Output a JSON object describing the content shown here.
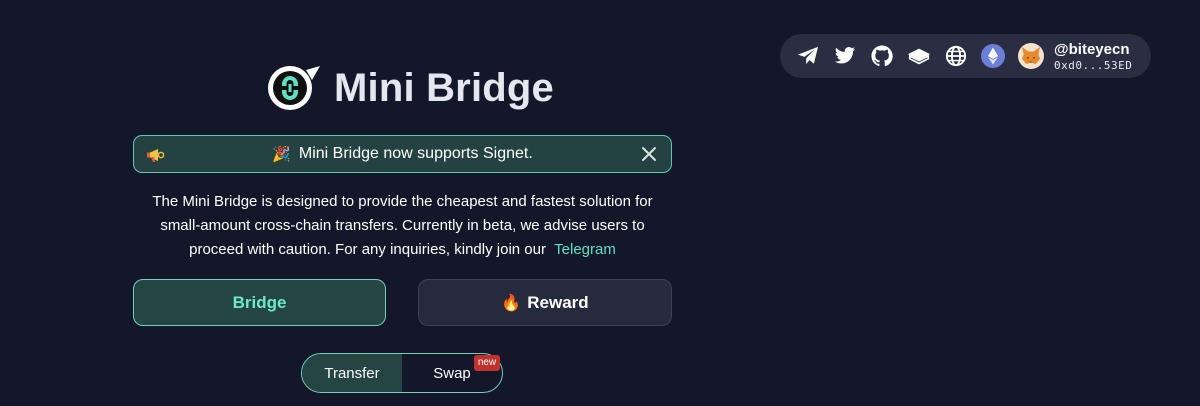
{
  "app": {
    "title": "Mini Bridge"
  },
  "topbar": {
    "icons": [
      "telegram-icon",
      "twitter-icon",
      "github-icon",
      "docs-icon",
      "globe-icon",
      "ethereum-icon"
    ],
    "account": {
      "name": "@biteyecn",
      "address": "0xd0...53ED",
      "avatar": "metamask-fox-icon"
    }
  },
  "announcement": {
    "icon": "megaphone-icon",
    "party": "🎉",
    "text": "Mini Bridge now supports Signet.",
    "close_icon": "close-icon"
  },
  "description": {
    "text": "The Mini Bridge is designed to provide the cheapest and fastest solution for small-amount cross-chain transfers. Currently in beta, we advise users to proceed with caution. For any inquiries, kindly join our",
    "link_text": "Telegram"
  },
  "tabs": {
    "bridge": "Bridge",
    "reward_emoji": "🔥",
    "reward": "Reward"
  },
  "mode": {
    "transfer": "Transfer",
    "swap": "Swap",
    "new_badge": "new"
  },
  "colors": {
    "background": "#131729",
    "accent": "#6ee8c8",
    "link": "#5fe0c4",
    "badge": "#c0322f"
  }
}
